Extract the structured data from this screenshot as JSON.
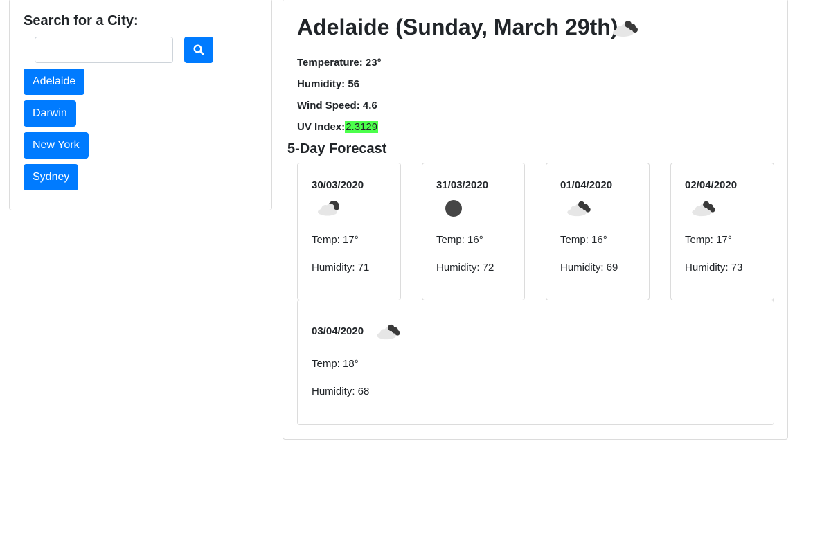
{
  "search": {
    "label": "Search for a City:",
    "input_value": "",
    "placeholder": "",
    "button_icon": "search-icon"
  },
  "history": [
    {
      "label": "Adelaide"
    },
    {
      "label": "Darwin"
    },
    {
      "label": "New York"
    },
    {
      "label": "Sydney"
    }
  ],
  "current": {
    "title": "Adelaide (Sunday, March 29th)",
    "icon": "cloud-icon",
    "temperature_label": "Temperature:",
    "temperature": "23°",
    "humidity_label": "Humidity:",
    "humidity": "56",
    "wind_label": "Wind Speed:",
    "wind": "4.6",
    "uv_label": "UV Index:",
    "uv": "2.3129",
    "uv_color": "#4cff4c"
  },
  "forecast": {
    "heading": "5-Day Forecast",
    "days": [
      {
        "date": "30/03/2020",
        "icon": "partly-cloudy-icon",
        "temp": "Temp: 17°",
        "humidity": "Humidity: 71"
      },
      {
        "date": "31/03/2020",
        "icon": "moon-icon",
        "temp": "Temp: 16°",
        "humidity": "Humidity: 72"
      },
      {
        "date": "01/04/2020",
        "icon": "cloud-icon",
        "temp": "Temp: 16°",
        "humidity": "Humidity: 69"
      },
      {
        "date": "02/04/2020",
        "icon": "cloud-icon",
        "temp": "Temp: 17°",
        "humidity": "Humidity: 73"
      },
      {
        "date": "03/04/2020",
        "icon": "cloud-icon",
        "temp": "Temp: 18°",
        "humidity": "Humidity: 68"
      }
    ]
  },
  "colors": {
    "primary": "#007bff",
    "border": "#dcdcdc",
    "text": "#212529"
  }
}
